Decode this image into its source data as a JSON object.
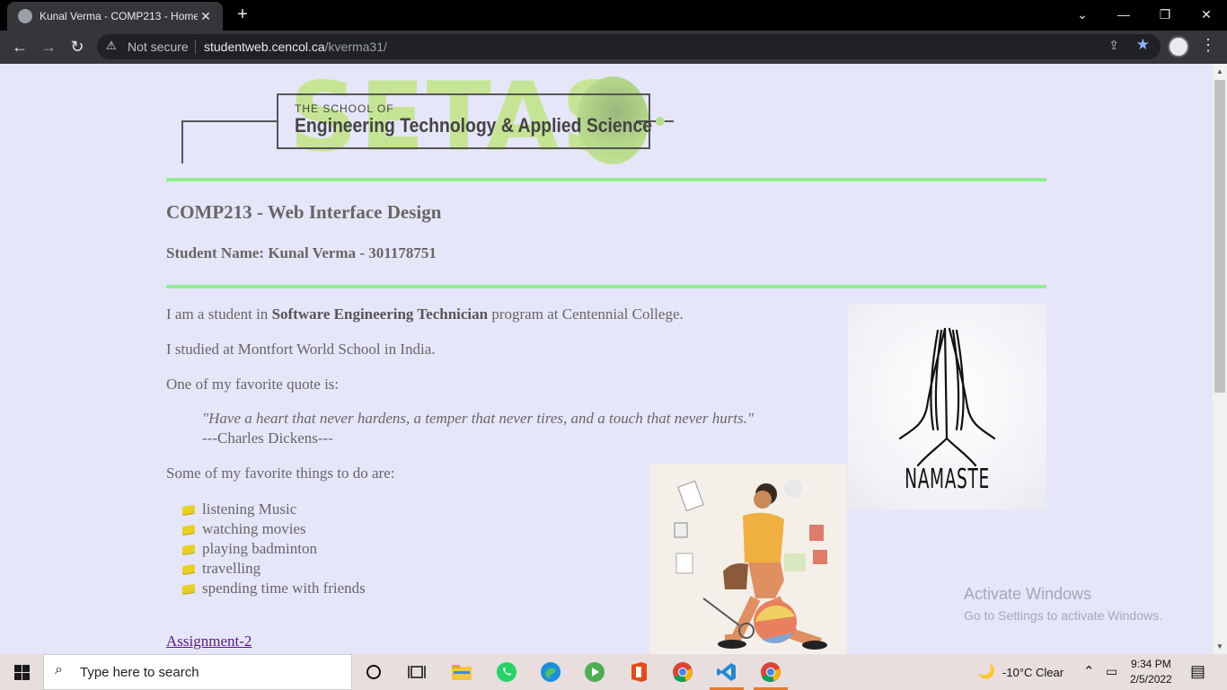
{
  "browser": {
    "tab_title": "Kunal Verma - COMP213 - Home",
    "tab_close": "✕",
    "new_tab": "+",
    "security_label": "Not secure",
    "url_host": "studentweb.cencol.ca",
    "url_path": "/kverma31/",
    "back": "←",
    "forward": "→",
    "reload": "↻",
    "menu": "⋮",
    "window_controls": {
      "tabs_dropdown": "⌄",
      "minimize": "—",
      "restore": "❐",
      "close": "✕"
    }
  },
  "page": {
    "logo": {
      "letters": "SETAS",
      "small": "THE SCHOOL OF",
      "name": "Engineering Technology & Applied Science"
    },
    "course_title": "COMP213 - Web Interface Design",
    "student_line": "Student Name: Kunal Verma - 301178751",
    "intro_prefix": "I am a student in ",
    "intro_bold": "Software Engineering Technician",
    "intro_suffix": " program at Centennial College.",
    "school": " I studied at Montfort World School in India.",
    "quote_intro": "One of my favorite quote is:",
    "quote": "\"Have a heart that never hardens, a temper that never tires, and a touch that never hurts.\"",
    "quote_author": "---Charles Dickens---",
    "things_intro": "Some of my favorite things to do are:",
    "things": [
      "listening Music",
      "watching movies",
      "playing badminton",
      "travelling",
      "spending time with friends"
    ],
    "assignment_link": "Assignment-2",
    "namaste_word": "NAMASTE"
  },
  "watermark": {
    "line1": "Activate Windows",
    "line2": "Go to Settings to activate Windows."
  },
  "taskbar": {
    "search_placeholder": "Type here to search",
    "weather": "-10°C  Clear",
    "time": "9:34 PM",
    "date": "2/5/2022"
  }
}
